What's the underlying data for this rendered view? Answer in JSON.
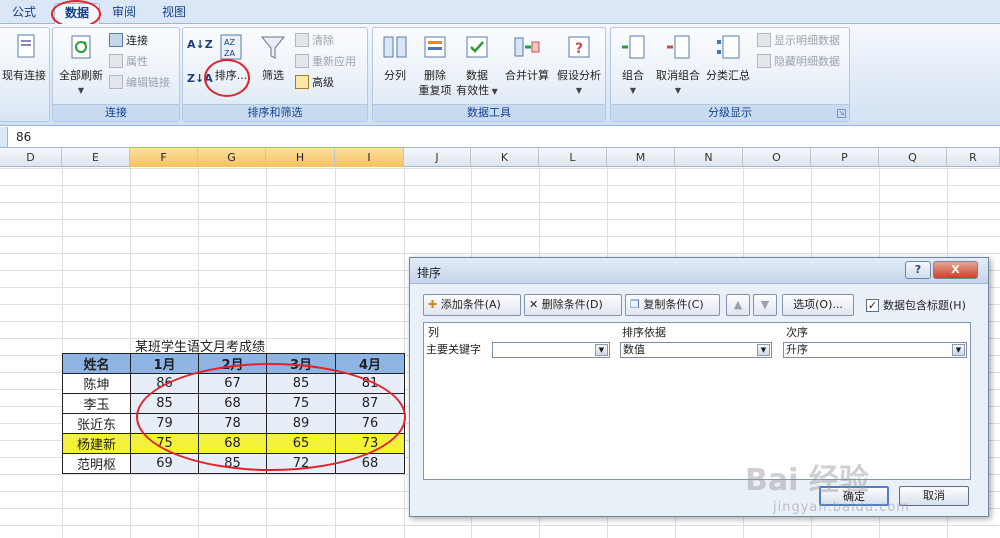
{
  "tabs": [
    {
      "label": "公式"
    },
    {
      "label": "数据"
    },
    {
      "label": "审阅"
    },
    {
      "label": "视图"
    }
  ],
  "ribbon": {
    "connections_group": {
      "label": "连接",
      "existing_conn": "现有连接",
      "refresh_all": "全部刷新",
      "connections": "连接",
      "properties": "属性",
      "edit_links": "编辑链接"
    },
    "sort_filter_group": {
      "label": "排序和筛选",
      "sort": "排序...",
      "filter": "筛选",
      "clear": "清除",
      "reapply": "重新应用",
      "advanced": "高级"
    },
    "data_tools_group": {
      "label": "数据工具",
      "text_to_columns": "分列",
      "remove_dup_1": "删除",
      "remove_dup_2": "重复项",
      "validation_1": "数据",
      "validation_2": "有效性",
      "consolidate": "合并计算",
      "what_if": "假设分析"
    },
    "outline_group": {
      "label": "分级显示",
      "group": "组合",
      "ungroup": "取消组合",
      "subtotal": "分类汇总",
      "show_detail": "显示明细数据",
      "hide_detail": "隐藏明细数据"
    }
  },
  "formula_bar": {
    "value": "86"
  },
  "columns": [
    "D",
    "E",
    "F",
    "G",
    "H",
    "I",
    "J",
    "K",
    "L",
    "M",
    "N",
    "O",
    "P",
    "Q",
    "R"
  ],
  "table": {
    "title": "某班学生语文月考成绩",
    "headers": [
      "姓名",
      "1月",
      "2月",
      "3月",
      "4月"
    ],
    "rows": [
      [
        "陈坤",
        "86",
        "67",
        "85",
        "81"
      ],
      [
        "李玉",
        "85",
        "68",
        "75",
        "87"
      ],
      [
        "张近东",
        "79",
        "78",
        "89",
        "76"
      ],
      [
        "杨建新",
        "75",
        "68",
        "65",
        "73"
      ],
      [
        "范明枢",
        "69",
        "85",
        "72",
        "68"
      ]
    ]
  },
  "dialog": {
    "title": "排序",
    "help": "?",
    "close": "X",
    "add_level": "添加条件(A)",
    "delete_level": "删除条件(D)",
    "copy_level": "复制条件(C)",
    "options": "选项(O)...",
    "has_headers": "数据包含标题(H)",
    "col_header": "列",
    "sort_on_header": "排序依据",
    "order_header": "次序",
    "row_label": "主要关键字",
    "sort_on_value": "数值",
    "order_value": "升序",
    "ok": "确定",
    "cancel": "取消"
  },
  "watermark": {
    "brand": "Bai 经验",
    "url": "jingyan.baidu.com"
  }
}
